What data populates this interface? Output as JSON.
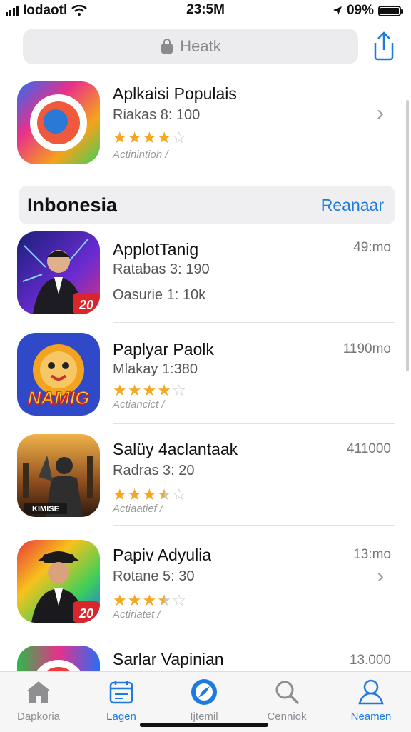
{
  "status_bar": {
    "carrier": "Iodaotl",
    "time": "23:5M",
    "battery": "09%"
  },
  "search": {
    "label": "Heatk"
  },
  "featured": {
    "title": "Aplkaisi Populais",
    "subtitle": "Riakas 8: 100",
    "rating_stars": 4,
    "caption": "Actinintioh  /",
    "chevron": "›"
  },
  "section": {
    "title": "Inbonesia",
    "action": "Reanaar"
  },
  "list": [
    {
      "title": "ApplotTanig",
      "subtitle": "Ratabas 3: 190",
      "extra": "Oasurie 1: 10k",
      "meta": "49:mo",
      "rating_stars": null,
      "caption": ""
    },
    {
      "title": "Paplyar Paolk",
      "subtitle": "Mlakay 1:380",
      "extra": "",
      "meta": "1190mo",
      "rating_stars": 4,
      "caption": "Actiancict  /"
    },
    {
      "title": "Salüy 4aclantaak",
      "subtitle": "Radras 3: 20",
      "extra": "",
      "meta": "411000",
      "rating_stars": 3.5,
      "caption": "Actiaatief  /"
    },
    {
      "title": "Papiv Adyulia",
      "subtitle": "Rotane 5: 30",
      "extra": "",
      "meta": "13:mo",
      "rating_stars": 3.5,
      "caption": "Actiriatet  /",
      "chevron": "›"
    },
    {
      "title": "Sarlar Vapinian",
      "subtitle": "",
      "extra": "",
      "meta": "13.000",
      "rating_stars": null,
      "caption": ""
    }
  ],
  "tabs": [
    {
      "label": "Dapkoria",
      "icon": "home-icon"
    },
    {
      "label": "Lagen",
      "icon": "calendar-icon"
    },
    {
      "label": "Ijtemil",
      "icon": "compass-icon"
    },
    {
      "label": "Cenniok",
      "icon": "search-icon"
    },
    {
      "label": "Neamen",
      "icon": "person-icon"
    }
  ],
  "colors": {
    "accent": "#1f7ae0",
    "star": "#f5a623"
  }
}
